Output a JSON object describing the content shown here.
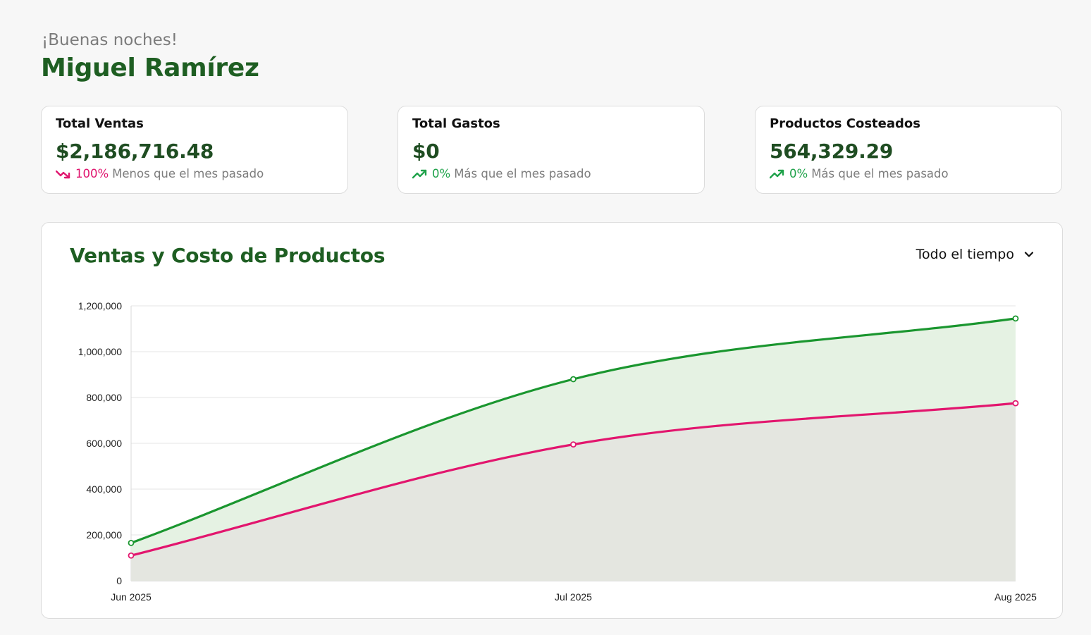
{
  "header": {
    "greeting": "¡Buenas noches!",
    "user_name": "Miguel Ramírez"
  },
  "stats": [
    {
      "title": "Total Ventas",
      "value": "$2,186,716.48",
      "trend_pct": "100%",
      "trend_text": "Menos que el mes pasado",
      "direction": "down",
      "color": "#e0166f"
    },
    {
      "title": "Total Gastos",
      "value": "$0",
      "trend_pct": "0%",
      "trend_text": "Más que el mes pasado",
      "direction": "up",
      "color": "#1fa24a"
    },
    {
      "title": "Productos Costeados",
      "value": "564,329.29",
      "trend_pct": "0%",
      "trend_text": "Más que el mes pasado",
      "direction": "up",
      "color": "#1fa24a"
    }
  ],
  "chart_section": {
    "title": "Ventas y Costo de Productos",
    "range_selected": "Todo el tiempo",
    "range_icon": "chevron-down-icon"
  },
  "chart_data": {
    "type": "area",
    "categories": [
      "Jun 2025",
      "Jul 2025",
      "Aug 2025"
    ],
    "series": [
      {
        "values": [
          165000,
          880000,
          1145000
        ],
        "color": "#1a962f",
        "fill": "#e5f2e3"
      },
      {
        "values": [
          110000,
          595000,
          775000
        ],
        "color": "#e2166e",
        "fill": "#e4e6e0"
      }
    ],
    "ylim": [
      0,
      1200000
    ],
    "yticks": [
      "0",
      "200,000",
      "400,000",
      "600,000",
      "800,000",
      "1,000,000",
      "1,200,000"
    ],
    "grid": true,
    "legend": "none"
  }
}
